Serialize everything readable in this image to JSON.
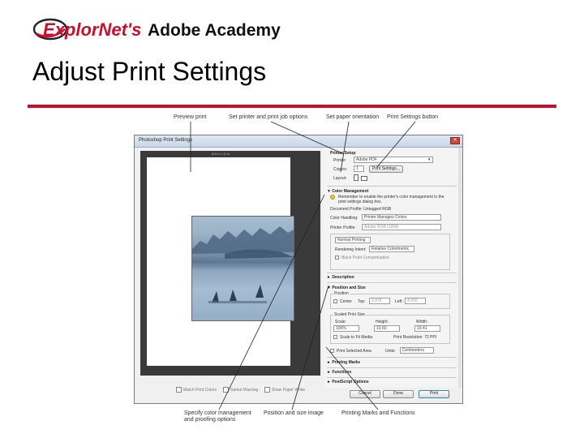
{
  "header": {
    "brand": "ExplorNet's",
    "brand_suffix": "Adobe Academy",
    "title": "Adjust Print Settings"
  },
  "callouts": {
    "preview_print": "Preview print",
    "set_printer": "Set printer and print job options",
    "set_orientation": "Set paper orientation",
    "print_settings_button": "Print Settings button",
    "color_management": "Specify color management and proofing options",
    "position_size": "Position and size image",
    "printing_marks": "Printing Marks and Functions"
  },
  "dialog": {
    "title": "Photoshop Print Settings",
    "paper_size": "8.5 in x 11 in",
    "bottom_checks": [
      "Match Print Colors",
      "Gamut Warning",
      "Show Paper White"
    ],
    "printer_setup": {
      "heading": "Printer Setup",
      "printer_label": "Printer:",
      "printer_value": "Adobe PDF",
      "copies_label": "Copies:",
      "copies_value": "1",
      "print_settings_button": "Print Settings...",
      "layout_label": "Layout:"
    },
    "color_management": {
      "heading": "Color Management",
      "note": "Remember to enable the printer's color management in the print settings dialog box.",
      "document_profile": "Document Profile: Untagged RGB",
      "color_handling_label": "Color Handling:",
      "color_handling_value": "Printer Manages Colors",
      "printer_profile_label": "Printer Profile:",
      "printer_profile_value": "Adobe RGB (1998)",
      "normal_printing": "Normal Printing",
      "rendering_intent_label": "Rendering Intent:",
      "rendering_intent_value": "Relative Colorimetric",
      "black_point": "Black Point Compensation"
    },
    "description": {
      "heading": "Description"
    },
    "position_size": {
      "heading": "Position and Size",
      "position_label": "Position",
      "center_label": "Center",
      "top_label": "Top:",
      "top_value": "2.476",
      "left_label": "Left:",
      "left_value": "4.250",
      "scaled_label": "Scaled Print Size",
      "scale_label": "Scale:",
      "scale_value": "100%",
      "height_label": "Height:",
      "height_value": "10.60",
      "width_label": "Width:",
      "width_value": "10.41",
      "scale_to_fit": "Scale to Fit Media",
      "print_resolution": "Print Resolution: 72 PPI",
      "print_selected": "Print Selected Area",
      "units_label": "Units:",
      "units_value": "Centimeters"
    },
    "collapsed_sections": [
      "Printing Marks",
      "Functions",
      "PostScript Options"
    ],
    "buttons": {
      "cancel": "Cancel",
      "done": "Done",
      "print": "Print"
    }
  },
  "colors": {
    "accent_rule": "#c8102e",
    "logo_red": "#c8102e",
    "logo_dark": "#222222",
    "print_button_border": "#3c7fb1"
  },
  "icons": {
    "logo": "explornet-globe-logo",
    "close": "close-icon",
    "expand": "triangle-icon",
    "orientation_portrait": "portrait-orientation-icon",
    "orientation_landscape": "landscape-orientation-icon"
  }
}
